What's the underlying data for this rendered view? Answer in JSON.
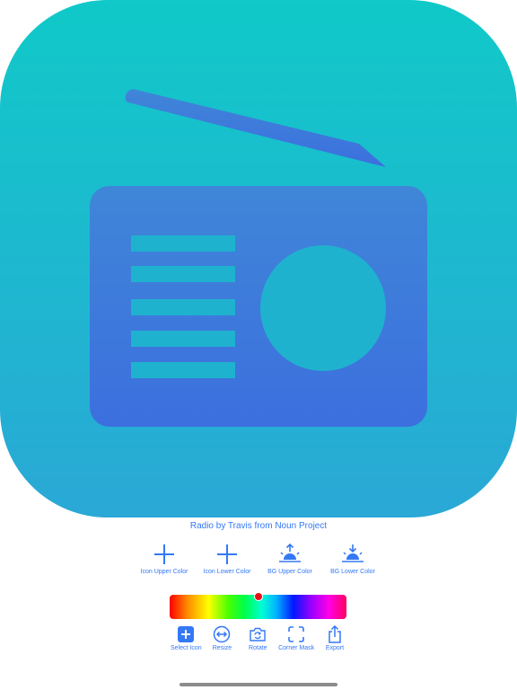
{
  "preview": {
    "icon_name": "radio-icon",
    "bg_upper_color": "#10c9c8",
    "bg_lower_color": "#2aa8d6",
    "icon_color": "#3f7fdc"
  },
  "attribution": "Radio by Travis from Noun Project",
  "color_buttons": [
    {
      "label": "Icon Upper Color",
      "icon": "plus-icon"
    },
    {
      "label": "Icon Lower Color",
      "icon": "plus-icon"
    },
    {
      "label": "BG Upper Color",
      "icon": "sunrise-icon"
    },
    {
      "label": "BG Lower Color",
      "icon": "sunset-icon"
    }
  ],
  "color_slider": {
    "hue_value": 0.5,
    "selected_color": "#e8101b"
  },
  "toolbar": [
    {
      "label": "Select Icon",
      "icon": "plus-square-icon"
    },
    {
      "label": "Resize",
      "icon": "resize-icon"
    },
    {
      "label": "Rotate",
      "icon": "rotate-camera-icon"
    },
    {
      "label": "Corner Mask",
      "icon": "corner-mask-icon"
    },
    {
      "label": "Export",
      "icon": "share-icon"
    }
  ],
  "accent_color": "#3478f6"
}
